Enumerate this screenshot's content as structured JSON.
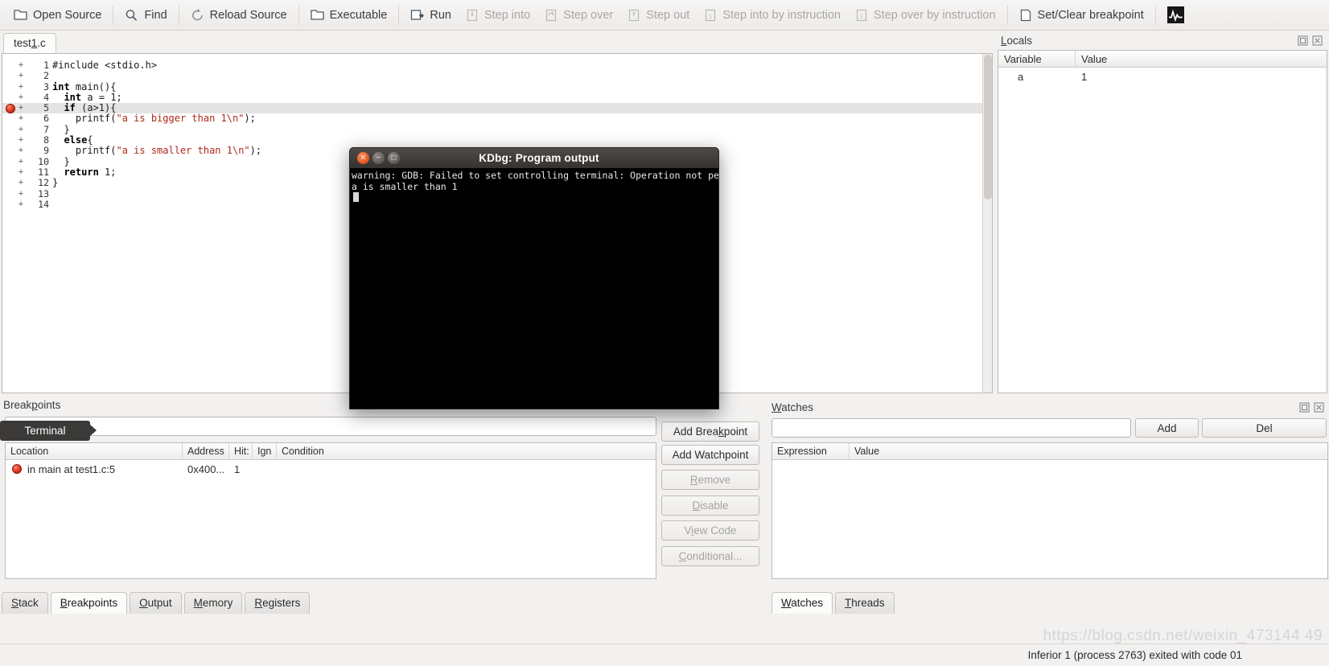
{
  "toolbar": {
    "items": [
      {
        "label": "Open Source",
        "icon": "folder-icon",
        "disabled": false
      },
      {
        "label": "Find",
        "icon": "search-icon",
        "disabled": false
      },
      {
        "label": "Reload Source",
        "icon": "reload-icon",
        "disabled": false
      },
      {
        "label": "Executable",
        "icon": "folder-icon",
        "disabled": false
      },
      {
        "label": "Run",
        "icon": "run-icon",
        "disabled": false
      },
      {
        "label": "Step into",
        "icon": "step-into-icon",
        "disabled": true
      },
      {
        "label": "Step over",
        "icon": "step-over-icon",
        "disabled": true
      },
      {
        "label": "Step out",
        "icon": "step-out-icon",
        "disabled": true
      },
      {
        "label": "Step into by instruction",
        "icon": "step-into-instr-icon",
        "disabled": true
      },
      {
        "label": "Step over by instruction",
        "icon": "step-over-instr-icon",
        "disabled": true
      },
      {
        "label": "Set/Clear breakpoint",
        "icon": "breakpoint-icon",
        "disabled": false
      },
      {
        "label": "",
        "icon": "pulse-icon",
        "disabled": false
      }
    ]
  },
  "source": {
    "tab_label": "test1.c",
    "tab_accel": "1",
    "breakpoint_line": 5,
    "current_line": 5,
    "lines": [
      {
        "n": "1",
        "text": "#include <stdio.h>"
      },
      {
        "n": "2",
        "text": ""
      },
      {
        "n": "3",
        "text": "int main(){"
      },
      {
        "n": "4",
        "text": "  int a = 1;"
      },
      {
        "n": "5",
        "text": "  if (a>1){"
      },
      {
        "n": "6",
        "text": "    printf(\"a is bigger than 1\\n\");"
      },
      {
        "n": "7",
        "text": "  }"
      },
      {
        "n": "8",
        "text": "  else{"
      },
      {
        "n": "9",
        "text": "    printf(\"a is smaller than 1\\n\");"
      },
      {
        "n": "10",
        "text": "  }"
      },
      {
        "n": "11",
        "text": "  return 1;"
      },
      {
        "n": "12",
        "text": "}"
      },
      {
        "n": "13",
        "text": ""
      },
      {
        "n": "14",
        "text": ""
      }
    ]
  },
  "locals": {
    "title": "Locals",
    "title_accel": "L",
    "columns": [
      "Variable",
      "Value"
    ],
    "rows": [
      {
        "variable": "a",
        "value": "1"
      }
    ],
    "float_icon": "float-icon",
    "close_icon": "close-icon"
  },
  "breakpoints": {
    "title": "Breakpoints",
    "title_accel": "p",
    "input_value": "",
    "columns": [
      "Location",
      "Address",
      "Hit:",
      "Ign",
      "Condition"
    ],
    "rows": [
      {
        "location": "in main at test1.c:5",
        "address": "0x400...",
        "hit": "1",
        "ign": "",
        "condition": "",
        "marker": "breakpoint-dot-icon"
      }
    ],
    "buttons": [
      {
        "label": "Add Breakpoint",
        "accel": "k",
        "disabled": false
      },
      {
        "label": "Add Watchpoint",
        "accel": "",
        "disabled": false
      },
      {
        "label": "Remove",
        "accel": "R",
        "disabled": true
      },
      {
        "label": "Disable",
        "accel": "D",
        "disabled": true
      },
      {
        "label": "View Code",
        "accel": "i",
        "disabled": true
      },
      {
        "label": "Conditional...",
        "accel": "C",
        "disabled": true
      }
    ]
  },
  "watches": {
    "title": "Watches",
    "title_accel": "W",
    "input_value": "",
    "add_label": "Add",
    "del_label": "Del",
    "columns": [
      "Expression",
      "Value"
    ],
    "rows": [],
    "float_icon": "float-icon",
    "close_icon": "close-icon"
  },
  "bottom_tabs_left": [
    {
      "label": "Stack",
      "accel": "S",
      "active": false
    },
    {
      "label": "Breakpoints",
      "accel": "B",
      "active": true
    },
    {
      "label": "Output",
      "accel": "O",
      "active": false
    },
    {
      "label": "Memory",
      "accel": "M",
      "active": false
    },
    {
      "label": "Registers",
      "accel": "R",
      "active": false
    }
  ],
  "bottom_tabs_right": [
    {
      "label": "Watches",
      "accel": "W",
      "active": true
    },
    {
      "label": "Threads",
      "accel": "T",
      "active": false
    }
  ],
  "terminal_tooltip": {
    "label": "Terminal"
  },
  "program_output_window": {
    "title": "KDbg: Program output",
    "close_icon": "window-close-icon",
    "minimize_icon": "window-minimize-icon",
    "maximize_icon": "window-maximize-icon",
    "lines": [
      "warning: GDB: Failed to set controlling terminal: Operation not permitted",
      "a is smaller than 1"
    ]
  },
  "statusbar": {
    "text": "Inferior 1 (process 2763) exited with code 01"
  },
  "watermark": {
    "text": "https://blog.csdn.net/weixin_473144 49"
  },
  "colors": {
    "accent_red": "#b0281a",
    "breakpoint_red": "#e23b25",
    "window_titlebar": "#413d3a",
    "terminal_bg": "#000000",
    "highlight_line": "#e4e4e4"
  }
}
